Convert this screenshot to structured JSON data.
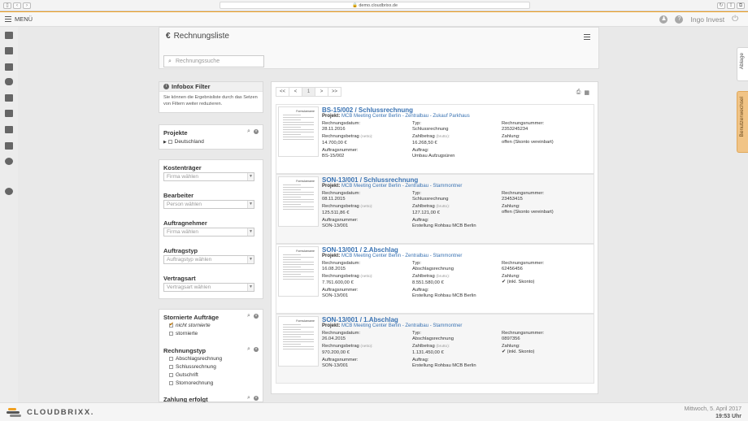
{
  "browser": {
    "url": "demo.cloudbrixx.de"
  },
  "header": {
    "menu_label": "MENÜ",
    "user_name": "Ingo Invest"
  },
  "page": {
    "title": "Rechnungsliste",
    "search_placeholder": "Rechnungssuche"
  },
  "infobox": {
    "title": "Infobox Filter",
    "text": "Sie können die Ergebnisliste durch das Setzen von Filtern weiter reduzieren."
  },
  "filters": {
    "projekte": {
      "title": "Projekte",
      "item": "Deutschland"
    },
    "kostentraeger": {
      "title": "Kostenträger",
      "placeholder": "Firma wählen"
    },
    "bearbeiter": {
      "title": "Bearbeiter",
      "placeholder": "Person wählen"
    },
    "auftragnehmer": {
      "title": "Auftragnehmer",
      "placeholder": "Firma wählen"
    },
    "auftragstyp": {
      "title": "Auftragstyp",
      "placeholder": "Auftragstyp wählen"
    },
    "vertragsart": {
      "title": "Vertragsart",
      "placeholder": "Vertragsart wählen"
    },
    "stornierte": {
      "title": "Stornierte Aufträge",
      "options": [
        "nicht stornierte",
        "stornierte"
      ]
    },
    "rechnungstyp": {
      "title": "Rechnungstyp",
      "options": [
        "Abschlagsrechnung",
        "Schlussrechnung",
        "Gutschrift",
        "Stornorechnung"
      ]
    },
    "zahlung": {
      "title": "Zahlung erfolgt"
    }
  },
  "pager": {
    "first": "<<",
    "prev": "<",
    "current": "1",
    "next": ">",
    "last": ">>"
  },
  "labels": {
    "projekt": "Projekt:",
    "rechnungsdatum": "Rechnungsdatum:",
    "typ": "Typ:",
    "rechnungsnummer": "Rechnungsnummer:",
    "rechnungsbetrag": "Rechnungsbetrag",
    "netto": "(netto):",
    "zahlbetrag": "Zahlbetrag",
    "brutto": "(brutto):",
    "zahlung": "Zahlung:",
    "auftragsnummer": "Auftragsnummer:",
    "auftrag": "Auftrag:"
  },
  "invoices": [
    {
      "title": "BS-15/002 / Schlussrechnung",
      "project": "MCB Meeting Center Berlin - Zentralbau - Zukauf Parkhaus",
      "date": "28.11.2016",
      "typ": "Schlussrechnung",
      "nummer": "2353245234",
      "betrag": "14.700,00 €",
      "zahlbetrag": "16.268,50 €",
      "zahlung": "offen (Skonto vereinbart)",
      "auftragsnummer": "BS-15/002",
      "auftrag": "Umbau Aufzugsüren",
      "paid_check": false
    },
    {
      "title": "SON-13/001 / Schlussrechnung",
      "project": "MCB Meeting Center Berlin - Zentralbau - Stammontner",
      "date": "08.11.2015",
      "typ": "Schlussrechnung",
      "nummer": "23453415",
      "betrag": "125.511,86 €",
      "zahlbetrag": "127.121,00 €",
      "zahlung": "offen (Skonto vereinbart)",
      "auftragsnummer": "SON-13/001",
      "auftrag": "Erstellung Rohbau MCB Berlin",
      "paid_check": false
    },
    {
      "title": "SON-13/001 / 2.Abschlag",
      "project": "MCB Meeting Center Berlin - Zentralbau - Stammontner",
      "date": "16.08.2015",
      "typ": "Abschlagsrechnung",
      "nummer": "62456456",
      "betrag": "7.761.600,00 €",
      "zahlbetrag": "8.551.580,00 €",
      "zahlung": "(inkl. Skonto)",
      "auftragsnummer": "SON-13/001",
      "auftrag": "Erstellung Rohbau MCB Berlin",
      "paid_check": true
    },
    {
      "title": "SON-13/001 / 1.Abschlag",
      "project": "MCB Meeting Center Berlin - Zentralbau - Stammontner",
      "date": "26.04.2015",
      "typ": "Abschlagsrechnung",
      "nummer": "0897356",
      "betrag": "970.200,00 €",
      "zahlbetrag": "1.131.450,00 €",
      "zahlung": "(inkl. Skonto)",
      "auftragsnummer": "SON-13/001",
      "auftrag": "Erstellung Rohbau MCB Berlin",
      "paid_check": true
    }
  ],
  "thumb_label": "Formularname",
  "side_tabs": {
    "ablage": "Ablage",
    "benutzerwechsel": "Benutzerwechsel"
  },
  "footer": {
    "brand": "CLOUDBRIXX.",
    "date": "Mittwoch, 5. April 2017",
    "time": "19:53 Uhr"
  },
  "colors": {
    "accent": "#f0a020",
    "link": "#3a73b3"
  }
}
